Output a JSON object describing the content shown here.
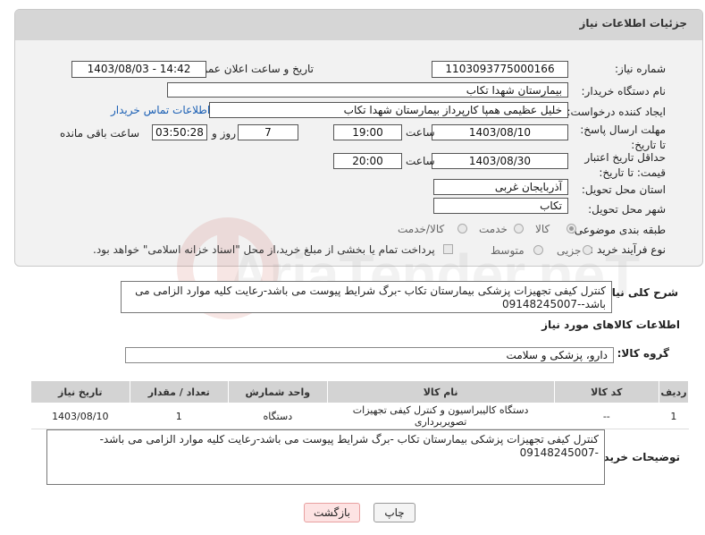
{
  "header": {
    "title": "جزئیات اطلاعات نیاز"
  },
  "fields": {
    "need_number_label": "شماره نیاز:",
    "need_number": "1103093775000166",
    "announce_label": "تاریخ و ساعت اعلان عمومی:",
    "announce_value": "1403/08/03 - 14:42",
    "buyer_label": "نام دستگاه خریدار:",
    "buyer_value": "بیمارستان شهدا تکاب",
    "creator_label": "ایجاد کننده درخواست:",
    "creator_value": "خلیل عظیمی همپا کارپرداز بیمارستان شهدا تکاب",
    "contact_link": "اطلاعات تماس خریدار",
    "deadline_label": "مهلت ارسال پاسخ: تا تاریخ:",
    "deadline_date": "1403/08/10",
    "time_word": "ساعت",
    "deadline_time": "19:00",
    "days_value": "7",
    "days_word": "روز و",
    "remaining_value": "03:50:28",
    "remaining_word": "ساعت باقی مانده",
    "validity_label": "حداقل تاریخ اعتبار قیمت: تا تاریخ:",
    "validity_date": "1403/08/30",
    "validity_time": "20:00",
    "province_label": "استان محل تحویل:",
    "province_value": "آذربایجان غربی",
    "city_label": "شهر محل تحویل:",
    "city_value": "تکاب",
    "category_label": "طبقه بندی موضوعی:",
    "category_options": [
      "کالا",
      "خدمت",
      "کالا/خدمت"
    ],
    "category_selected": "کالا",
    "process_label": "نوع فرآیند خرید :",
    "process_options": [
      "جزیی",
      "متوسط"
    ],
    "process_note": "پرداخت تمام یا بخشی از مبلغ خرید،از محل \"اسناد خزانه اسلامی\" خواهد بود."
  },
  "description": {
    "label": "شرح کلی نیاز:",
    "text": "کنترل کیفی تجهیزات پزشکی بیمارستان تکاب -برگ شرایط پیوست می باشد-رعایت کلیه موارد الزامی می باشد--09148245007"
  },
  "goods": {
    "section_title": "اطلاعات کالاهای مورد نیاز",
    "group_label": "گروه کالا:",
    "group_value": "دارو، پزشکی و سلامت",
    "columns": [
      "ردیف",
      "کد کالا",
      "نام کالا",
      "واحد شمارش",
      "تعداد / مقدار",
      "تاریخ نیاز"
    ],
    "rows": [
      [
        "1",
        "--",
        "دستگاه کالیبراسیون و کنترل کیفی تجهیزات تصویربرداری",
        "دستگاه",
        "1",
        "1403/08/10"
      ]
    ]
  },
  "buyer_notes": {
    "label": "توضیحات خریدار:",
    "text": "کنترل کیفی تجهیزات پزشکی بیمارستان تکاب -برگ شرایط پیوست می باشد-رعایت کلیه موارد الزامی می باشد--09148245007"
  },
  "buttons": {
    "print": "چاپ",
    "back": "بازگشت"
  },
  "watermark": {
    "text": "AriaTender.neT"
  },
  "colors": {
    "link": "#1a5fb4",
    "back_button_bg": "#fde3e3",
    "header_bg": "#d6d6d6"
  }
}
